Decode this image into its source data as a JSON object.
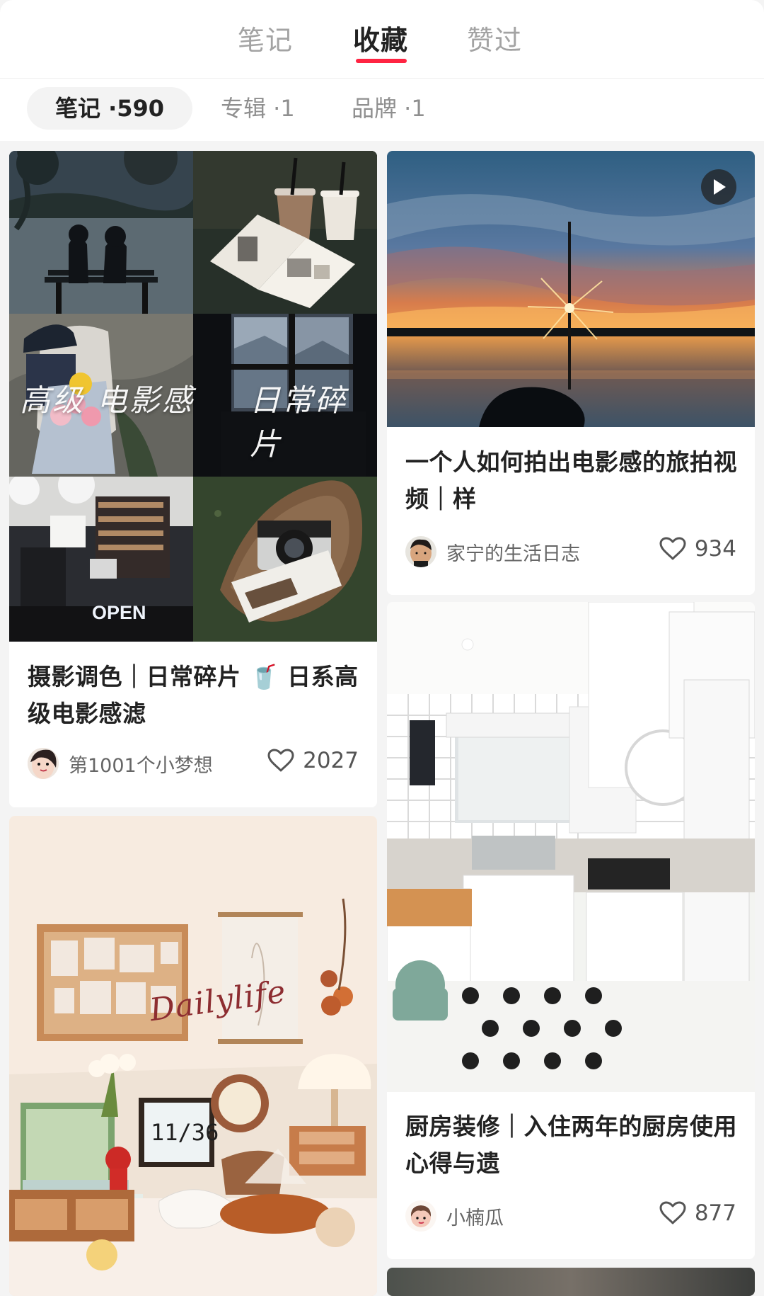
{
  "tabs": {
    "notes": "笔记",
    "favorites": "收藏",
    "liked": "赞过",
    "accent_color": "#ff2442"
  },
  "subtabs": {
    "notes": "笔记 ·590",
    "albums": "专辑 ·1",
    "brands": "品牌 ·1"
  },
  "cards": [
    {
      "title": "摄影调色｜日常碎片 🥤 日系高级电影感滤",
      "overlay_text_left": "高级 电影感",
      "overlay_text_right": "日常碎片",
      "author": "第1001个小梦想",
      "likes": "2027"
    },
    {
      "title": "一个人如何拍出电影感的旅拍视频｜样",
      "author": "家宁的生活日志",
      "likes": "934",
      "video": true
    },
    {
      "title": "厨房装修｜入住两年的厨房使用心得与遗",
      "author": "小楠瓜",
      "likes": "877"
    },
    {
      "overlay_text": "Dailylife"
    }
  ],
  "icons": {
    "like": "heart-outline-icon",
    "play": "play-icon"
  }
}
